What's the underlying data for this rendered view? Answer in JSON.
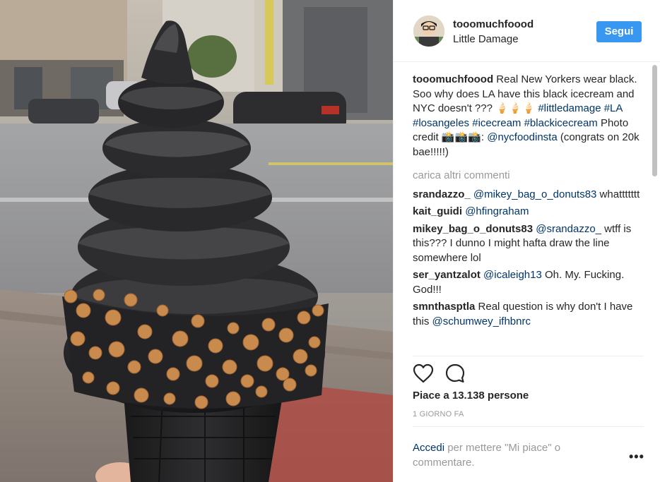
{
  "post": {
    "username": "tooomuchfoood",
    "location": "Little Damage",
    "follow_label": "Segui",
    "caption": {
      "text_1": " Real New Yorkers wear black. Soo why does LA have this black icecream and NYC doesn't ??? 🍦🍦🍦 ",
      "hashtags": "#littledamage #LA #losangeles #icecream #blackicecream",
      "text_2": " Photo credit 📸📸📸: ",
      "mention": "@nycfoodinsta",
      "text_3": " (congrats on 20k bae!!!!!)"
    },
    "load_more_label": "carica altri commenti",
    "comments": [
      {
        "user": "srandazzo_",
        "mention": "@mikey_bag_o_donuts83",
        "text": " whattttttt"
      },
      {
        "user": "kait_guidi",
        "mention": "@hfingraham",
        "text": ""
      },
      {
        "user": "mikey_bag_o_donuts83",
        "mention": "@srandazzo_",
        "text": " wtff is this??? I dunno I might hafta draw the line somewhere lol"
      },
      {
        "user": "ser_yantzalot",
        "mention": "@icaleigh13",
        "text": " Oh. My. Fucking. God!!!"
      },
      {
        "user": "smnthasptla",
        "mention": "",
        "text": " Real question is why don't I have this ",
        "mention_after": "@schumwey_ifhbnrc"
      }
    ],
    "likes_text": "Piace a 13.138 persone",
    "timestamp": "1 GIORNO FA",
    "login_link": "Accedi",
    "login_text": " per mettere \"Mi piace\" o commentare.",
    "more_icon": "more-options-icon",
    "icons": {
      "like": "heart-icon",
      "comment": "comment-bubble-icon"
    },
    "colors": {
      "follow_button": "#3897f0",
      "link": "#003569",
      "muted": "#999999",
      "text": "#262626"
    }
  }
}
